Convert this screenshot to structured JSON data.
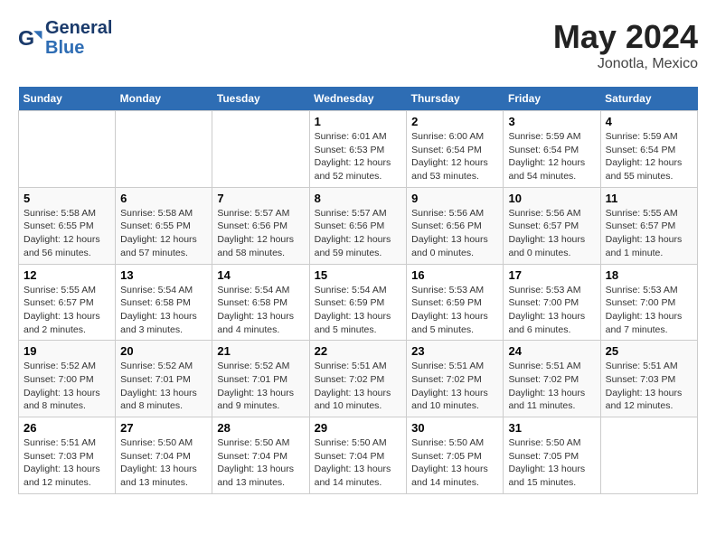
{
  "header": {
    "logo_line1": "General",
    "logo_line2": "Blue",
    "month": "May 2024",
    "location": "Jonotla, Mexico"
  },
  "days_of_week": [
    "Sunday",
    "Monday",
    "Tuesday",
    "Wednesday",
    "Thursday",
    "Friday",
    "Saturday"
  ],
  "weeks": [
    [
      {
        "day": "",
        "info": ""
      },
      {
        "day": "",
        "info": ""
      },
      {
        "day": "",
        "info": ""
      },
      {
        "day": "1",
        "info": "Sunrise: 6:01 AM\nSunset: 6:53 PM\nDaylight: 12 hours\nand 52 minutes."
      },
      {
        "day": "2",
        "info": "Sunrise: 6:00 AM\nSunset: 6:54 PM\nDaylight: 12 hours\nand 53 minutes."
      },
      {
        "day": "3",
        "info": "Sunrise: 5:59 AM\nSunset: 6:54 PM\nDaylight: 12 hours\nand 54 minutes."
      },
      {
        "day": "4",
        "info": "Sunrise: 5:59 AM\nSunset: 6:54 PM\nDaylight: 12 hours\nand 55 minutes."
      }
    ],
    [
      {
        "day": "5",
        "info": "Sunrise: 5:58 AM\nSunset: 6:55 PM\nDaylight: 12 hours\nand 56 minutes."
      },
      {
        "day": "6",
        "info": "Sunrise: 5:58 AM\nSunset: 6:55 PM\nDaylight: 12 hours\nand 57 minutes."
      },
      {
        "day": "7",
        "info": "Sunrise: 5:57 AM\nSunset: 6:56 PM\nDaylight: 12 hours\nand 58 minutes."
      },
      {
        "day": "8",
        "info": "Sunrise: 5:57 AM\nSunset: 6:56 PM\nDaylight: 12 hours\nand 59 minutes."
      },
      {
        "day": "9",
        "info": "Sunrise: 5:56 AM\nSunset: 6:56 PM\nDaylight: 13 hours\nand 0 minutes."
      },
      {
        "day": "10",
        "info": "Sunrise: 5:56 AM\nSunset: 6:57 PM\nDaylight: 13 hours\nand 0 minutes."
      },
      {
        "day": "11",
        "info": "Sunrise: 5:55 AM\nSunset: 6:57 PM\nDaylight: 13 hours\nand 1 minute."
      }
    ],
    [
      {
        "day": "12",
        "info": "Sunrise: 5:55 AM\nSunset: 6:57 PM\nDaylight: 13 hours\nand 2 minutes."
      },
      {
        "day": "13",
        "info": "Sunrise: 5:54 AM\nSunset: 6:58 PM\nDaylight: 13 hours\nand 3 minutes."
      },
      {
        "day": "14",
        "info": "Sunrise: 5:54 AM\nSunset: 6:58 PM\nDaylight: 13 hours\nand 4 minutes."
      },
      {
        "day": "15",
        "info": "Sunrise: 5:54 AM\nSunset: 6:59 PM\nDaylight: 13 hours\nand 5 minutes."
      },
      {
        "day": "16",
        "info": "Sunrise: 5:53 AM\nSunset: 6:59 PM\nDaylight: 13 hours\nand 5 minutes."
      },
      {
        "day": "17",
        "info": "Sunrise: 5:53 AM\nSunset: 7:00 PM\nDaylight: 13 hours\nand 6 minutes."
      },
      {
        "day": "18",
        "info": "Sunrise: 5:53 AM\nSunset: 7:00 PM\nDaylight: 13 hours\nand 7 minutes."
      }
    ],
    [
      {
        "day": "19",
        "info": "Sunrise: 5:52 AM\nSunset: 7:00 PM\nDaylight: 13 hours\nand 8 minutes."
      },
      {
        "day": "20",
        "info": "Sunrise: 5:52 AM\nSunset: 7:01 PM\nDaylight: 13 hours\nand 8 minutes."
      },
      {
        "day": "21",
        "info": "Sunrise: 5:52 AM\nSunset: 7:01 PM\nDaylight: 13 hours\nand 9 minutes."
      },
      {
        "day": "22",
        "info": "Sunrise: 5:51 AM\nSunset: 7:02 PM\nDaylight: 13 hours\nand 10 minutes."
      },
      {
        "day": "23",
        "info": "Sunrise: 5:51 AM\nSunset: 7:02 PM\nDaylight: 13 hours\nand 10 minutes."
      },
      {
        "day": "24",
        "info": "Sunrise: 5:51 AM\nSunset: 7:02 PM\nDaylight: 13 hours\nand 11 minutes."
      },
      {
        "day": "25",
        "info": "Sunrise: 5:51 AM\nSunset: 7:03 PM\nDaylight: 13 hours\nand 12 minutes."
      }
    ],
    [
      {
        "day": "26",
        "info": "Sunrise: 5:51 AM\nSunset: 7:03 PM\nDaylight: 13 hours\nand 12 minutes."
      },
      {
        "day": "27",
        "info": "Sunrise: 5:50 AM\nSunset: 7:04 PM\nDaylight: 13 hours\nand 13 minutes."
      },
      {
        "day": "28",
        "info": "Sunrise: 5:50 AM\nSunset: 7:04 PM\nDaylight: 13 hours\nand 13 minutes."
      },
      {
        "day": "29",
        "info": "Sunrise: 5:50 AM\nSunset: 7:04 PM\nDaylight: 13 hours\nand 14 minutes."
      },
      {
        "day": "30",
        "info": "Sunrise: 5:50 AM\nSunset: 7:05 PM\nDaylight: 13 hours\nand 14 minutes."
      },
      {
        "day": "31",
        "info": "Sunrise: 5:50 AM\nSunset: 7:05 PM\nDaylight: 13 hours\nand 15 minutes."
      },
      {
        "day": "",
        "info": ""
      }
    ]
  ]
}
